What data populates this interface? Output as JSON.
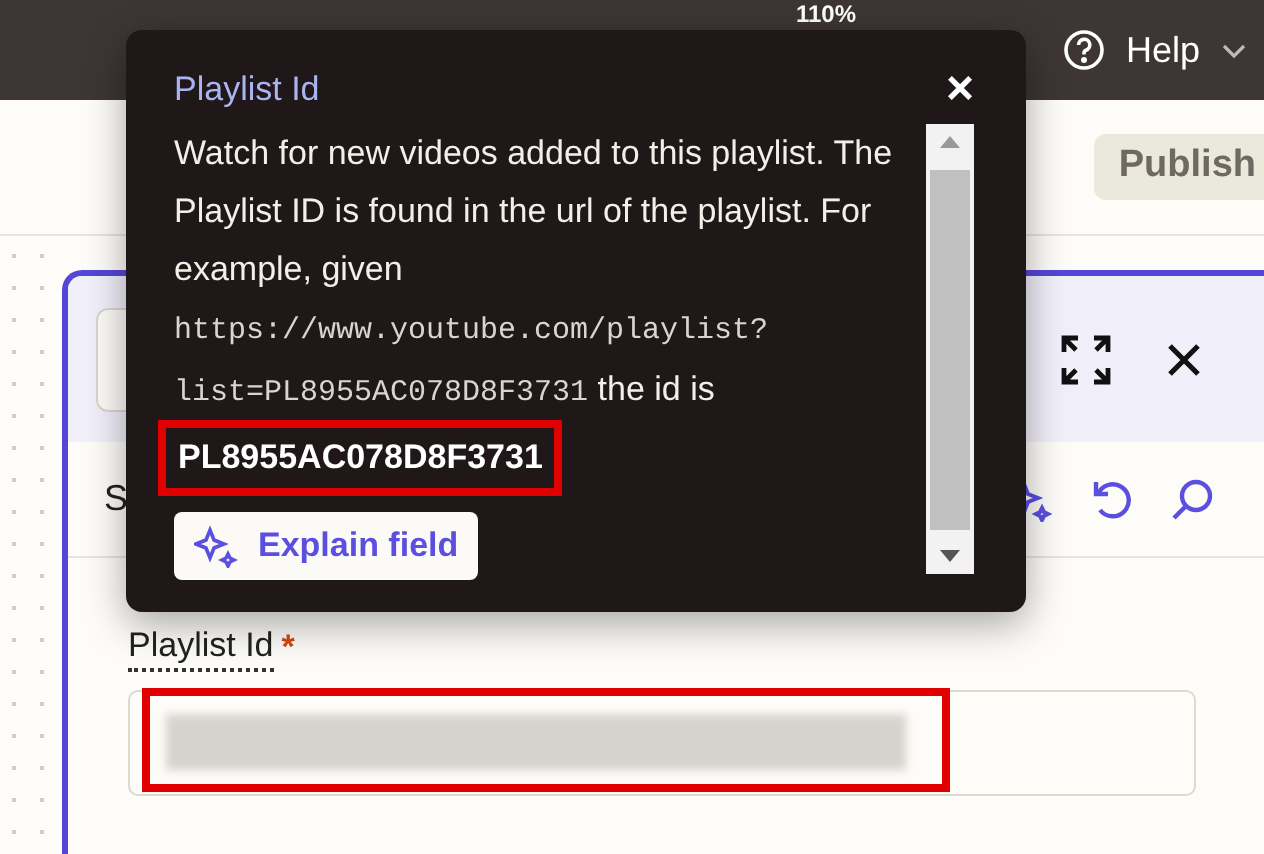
{
  "top_bar": {
    "zoom": "110%",
    "help": "Help"
  },
  "toolbar": {
    "publish": "Publish"
  },
  "panel": {
    "section_label": "S",
    "field": {
      "label": "Playlist Id",
      "required_mark": "*",
      "value_redacted": true,
      "highlighted": true
    }
  },
  "tooltip": {
    "title": "Playlist Id",
    "close": "×",
    "parts": [
      {
        "kind": "text",
        "text": "Watch for new videos added to this playlist. The Playlist ID is found in the url of the playlist. For example, given "
      },
      {
        "kind": "code",
        "text": "https://www.youtube.com/playlist?list=PL8955AC078D8F3731"
      },
      {
        "kind": "text",
        "text": " the id is "
      }
    ],
    "example_id": {
      "text": "PL8955AC078D8F3731",
      "highlighted": true
    },
    "explain_button": "Explain field"
  }
}
